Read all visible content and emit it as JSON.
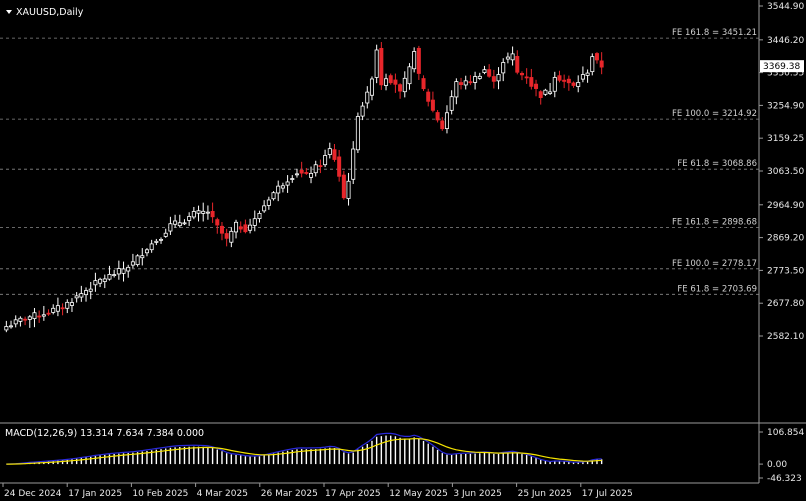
{
  "symbol": "XAUUSD,Daily",
  "current_price": "3369.38",
  "price_axis": {
    "min": 2582.1,
    "max": 3544.9,
    "ticks": [
      "3544.90",
      "3446.20",
      "3350.55",
      "3254.90",
      "3159.25",
      "3063.50",
      "2964.90",
      "2869.20",
      "2773.50",
      "2677.80",
      "2582.10"
    ]
  },
  "fib_levels": [
    {
      "label": "FE 161.8 = 3451.21",
      "value": 3451.21
    },
    {
      "label": "FE 100.0 = 3214.92",
      "value": 3214.92
    },
    {
      "label": "FE 61.8 = 3068.86",
      "value": 3068.86
    },
    {
      "label": "FE 161.8 = 2898.68",
      "value": 2898.68
    },
    {
      "label": "FE 100.0 = 2778.17",
      "value": 2778.17
    },
    {
      "label": "FE 61.8 = 2703.69",
      "value": 2703.69
    }
  ],
  "macd": {
    "title": "MACD(12,26,9) 13.314 7.634 7.384 0.000",
    "ticks": [
      "106.854",
      "0.00",
      "-46.323"
    ],
    "max": 106.854,
    "min": -46.323
  },
  "date_ticks": [
    "24 Dec 2024",
    "17 Jan 2025",
    "10 Feb 2025",
    "4 Mar 2025",
    "26 Mar 2025",
    "17 Apr 2025",
    "12 May 2025",
    "3 Jun 2025",
    "25 Jun 2025",
    "17 Jul 2025"
  ],
  "colors": {
    "bull": "#ffffff",
    "bear": "#e8262b",
    "signal": "#f5e400",
    "macd_line": "#2a2adc",
    "grid": "#8a8a8a",
    "hist_pos": "#ffffff",
    "hist_neg": "#e8262b"
  },
  "chart_data": {
    "type": "candlestick",
    "anchors": [
      [
        0,
        2610
      ],
      [
        4,
        2635
      ],
      [
        8,
        2648
      ],
      [
        12,
        2668
      ],
      [
        16,
        2706
      ],
      [
        20,
        2745
      ],
      [
        24,
        2770
      ],
      [
        27,
        2795
      ],
      [
        30,
        2840
      ],
      [
        33,
        2873
      ],
      [
        35,
        2905
      ],
      [
        38,
        2920
      ],
      [
        40,
        2938
      ],
      [
        43,
        2945
      ],
      [
        45,
        2900
      ],
      [
        47,
        2862
      ],
      [
        49,
        2905
      ],
      [
        51,
        2895
      ],
      [
        53,
        2920
      ],
      [
        56,
        2985
      ],
      [
        58,
        3015
      ],
      [
        60,
        3040
      ],
      [
        62,
        3060
      ],
      [
        64,
        3050
      ],
      [
        67,
        3085
      ],
      [
        69,
        3125
      ],
      [
        70,
        3100
      ],
      [
        71,
        3050
      ],
      [
        72,
        2985
      ],
      [
        73,
        3040
      ],
      [
        74,
        3120
      ],
      [
        75,
        3230
      ],
      [
        77,
        3285
      ],
      [
        78,
        3340
      ],
      [
        79,
        3420
      ],
      [
        80,
        3320
      ],
      [
        81,
        3340
      ],
      [
        83,
        3320
      ],
      [
        84,
        3290
      ],
      [
        86,
        3360
      ],
      [
        87,
        3420
      ],
      [
        88,
        3340
      ],
      [
        89,
        3300
      ],
      [
        91,
        3240
      ],
      [
        93,
        3190
      ],
      [
        95,
        3280
      ],
      [
        96,
        3320
      ],
      [
        98,
        3320
      ],
      [
        100,
        3335
      ],
      [
        102,
        3360
      ],
      [
        104,
        3320
      ],
      [
        106,
        3385
      ],
      [
        108,
        3400
      ],
      [
        109,
        3350
      ],
      [
        111,
        3340
      ],
      [
        112,
        3315
      ],
      [
        114,
        3285
      ],
      [
        116,
        3300
      ],
      [
        117,
        3345
      ],
      [
        119,
        3325
      ],
      [
        121,
        3310
      ],
      [
        123,
        3340
      ],
      [
        124,
        3355
      ],
      [
        125,
        3400
      ],
      [
        126,
        3380
      ],
      [
        127,
        3370
      ]
    ]
  }
}
